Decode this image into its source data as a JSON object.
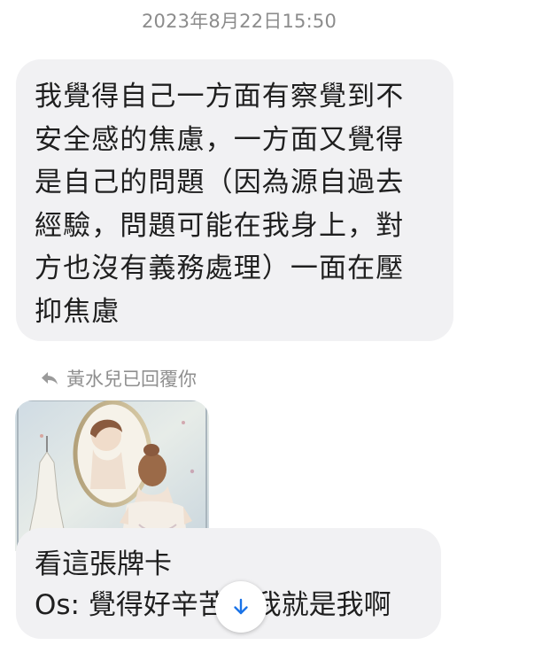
{
  "timestamp": "2023年8月22日15:50",
  "incoming_message": {
    "lines": [
      "我覺得自己一方面有察覺到不",
      "安全感的焦慮，一方面又覺得",
      "是自己的問題（因為源自過去",
      "經驗，問題可能在我身上，對",
      "方也沒有義務處理）一面在壓",
      "抑焦慮"
    ]
  },
  "reply": {
    "header": "黃水兒已回覆你",
    "icon": "reply-arrow-icon",
    "attachment": {
      "type": "tarot-card-image",
      "icon": "card-image"
    },
    "lines": [
      "看這張牌卡",
      "Os: 覺得好辛苦",
      "我就是我啊"
    ]
  },
  "scroll_button": {
    "icon": "arrow-down-icon",
    "color": "#1a73e8"
  },
  "colors": {
    "bubble": "#f1f1f3",
    "timestamp": "#8c8c8c",
    "text": "#1f1f1f"
  }
}
